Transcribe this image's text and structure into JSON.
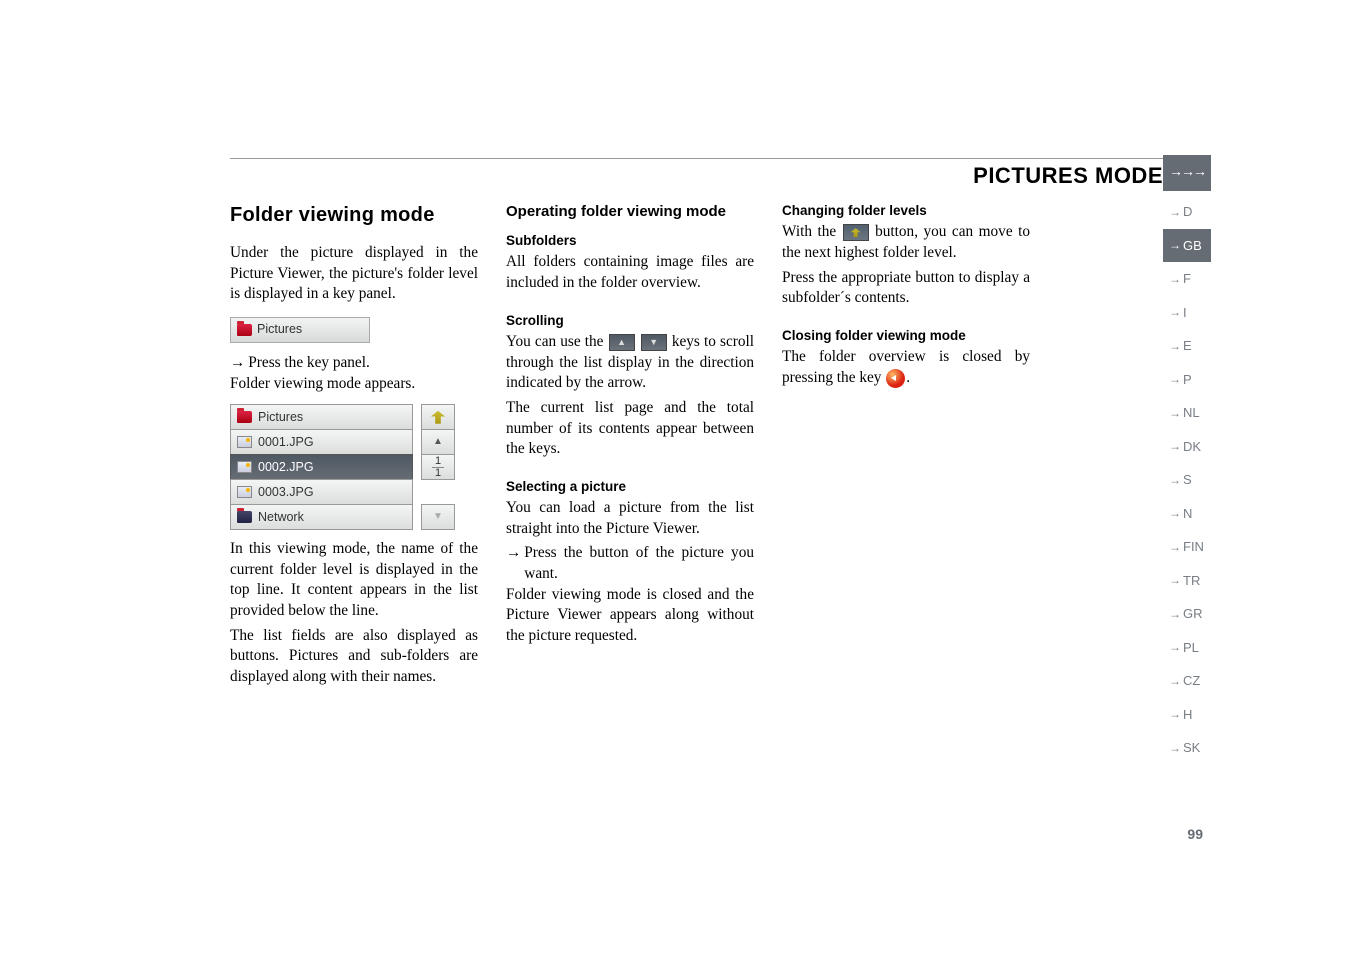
{
  "header": {
    "mode_title": "PICTURES MODE",
    "arrows": "→→→"
  },
  "col1": {
    "h1": "Folder viewing mode",
    "p1": "Under the picture displayed in the Picture Viewer, the picture's folder level is displayed in a key panel.",
    "key_panel_label": "Pictures",
    "press_key_panel": "Press the key panel.",
    "folder_appears": "Folder viewing mode appears.",
    "list": {
      "header": "Pictures",
      "items": [
        "0001.JPG",
        "0002.JPG",
        "0003.JPG"
      ],
      "network": "Network",
      "page_indicator_top": "1",
      "page_indicator_bottom": "1"
    },
    "p2": "In this viewing mode, the name of the current folder level is displayed in the top line. It content appears in the list provided below the line.",
    "p3": "The list fields are also displayed as buttons. Pictures and sub-folders are displayed along with their names."
  },
  "col2": {
    "h2": "Operating folder viewing mode",
    "subfolders_h": "Subfolders",
    "subfolders_p": "All folders containing image files are included in the folder overview.",
    "scrolling_h": "Scrolling",
    "scrolling_pre": "You can use the ",
    "scrolling_post": " keys to scroll through the list display in the direction indicated by the arrow.",
    "scrolling_p2": "The current list page and the total number of its contents appear between the keys.",
    "select_h": "Selecting a picture",
    "select_p1": "You can load a picture from the list straight into the Picture Viewer.",
    "select_press": "Press the button of the picture you want.",
    "select_p2": "Folder viewing mode is closed and the Picture Viewer appears along without the picture requested."
  },
  "col3": {
    "change_h": "Changing folder levels",
    "change_p1a": "With the ",
    "change_p1b": " button, you can move to the next highest folder level.",
    "change_p2": "Press the appropriate button to display a subfolder´s contents.",
    "close_h": "Closing folder viewing mode",
    "close_p_a": "The folder overview is closed by pressing the key ",
    "close_p_b": "."
  },
  "sidebar": {
    "items": [
      "D",
      "GB",
      "F",
      "I",
      "E",
      "P",
      "NL",
      "DK",
      "S",
      "N",
      "FIN",
      "TR",
      "GR",
      "PL",
      "CZ",
      "H",
      "SK"
    ],
    "active_index": 1
  },
  "page_number": "99"
}
